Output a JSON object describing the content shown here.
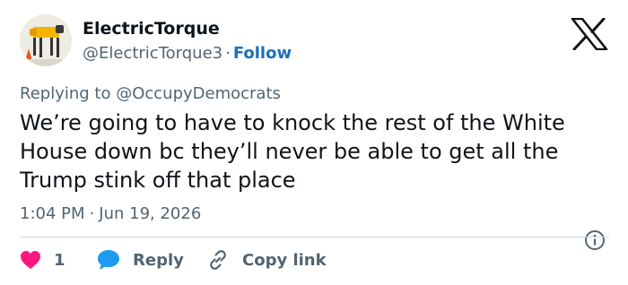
{
  "author": {
    "name": "ElectricTorque",
    "handle": "@ElectricTorque3",
    "separator": "·",
    "follow_label": "Follow"
  },
  "reply_context": "Replying to @OccupyDemocrats",
  "tweet": {
    "text": "We’re going to have to knock the rest of the White House down bc they’ll never be able to get all the Trump stink off that place"
  },
  "meta": {
    "time": "1:04 PM",
    "separator": "·",
    "date": "Jun 19, 2026"
  },
  "actions": {
    "like_count": "1",
    "reply_label": "Reply",
    "copy_label": "Copy link"
  },
  "icons": {
    "logo": "x-logo-icon",
    "info": "info-icon",
    "like": "heart-icon",
    "reply": "speech-bubble-icon",
    "copy": "link-icon"
  },
  "colors": {
    "text_primary": "#0f1419",
    "text_secondary": "#536471",
    "follow_link": "#1d6fb8",
    "like_heart": "#f91880",
    "reply_bubble": "#1d9bf0",
    "divider": "#cfd9de"
  }
}
